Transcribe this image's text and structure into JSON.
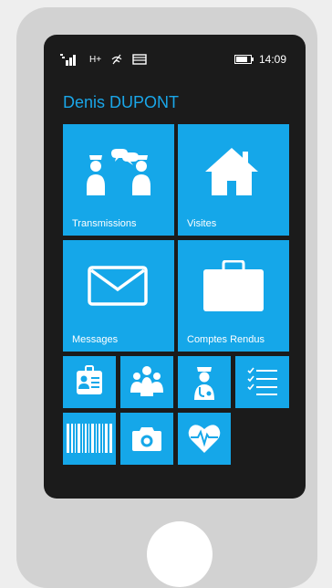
{
  "status_bar": {
    "network": "H+",
    "time": "14:09",
    "signal_icon": "signal-bars-icon",
    "wifi_icon": "wifi-icon",
    "sim_icon": "sim-card-icon",
    "battery_icon": "battery-icon"
  },
  "user": {
    "name": "Denis DUPONT"
  },
  "tiles": {
    "transmissions": {
      "label": "Transmissions",
      "icon": "nurses-chat-icon"
    },
    "visites": {
      "label": "Visites",
      "icon": "house-icon"
    },
    "messages": {
      "label": "Messages",
      "icon": "envelope-icon"
    },
    "comptes_rendus": {
      "label": "Comptes Rendus",
      "icon": "briefcase-icon"
    },
    "small": [
      {
        "icon": "id-badge-icon"
      },
      {
        "icon": "group-people-icon"
      },
      {
        "icon": "doctor-icon"
      },
      {
        "icon": "checklist-icon"
      },
      {
        "icon": "barcode-icon"
      },
      {
        "icon": "camera-icon"
      },
      {
        "icon": "heart-rate-icon"
      }
    ]
  },
  "colors": {
    "tile": "#15a7e9",
    "title": "#1aa6e8",
    "screen": "#1b1b1b",
    "device": "#d2d2d2"
  }
}
